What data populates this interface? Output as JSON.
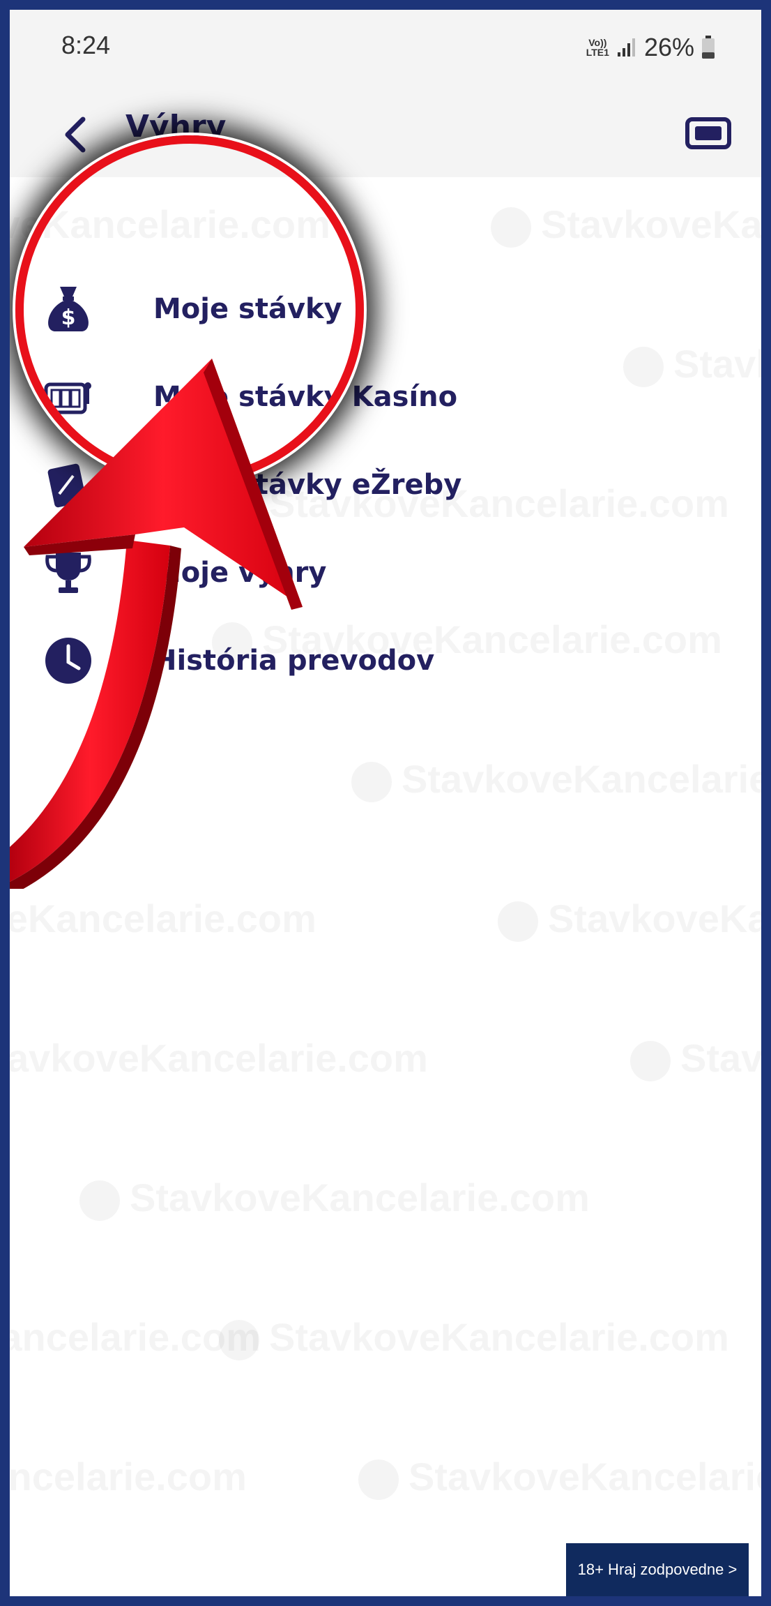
{
  "status_bar": {
    "time": "8:24",
    "volte_top": "Vo))",
    "volte_bottom": "LTE1",
    "battery": "26%"
  },
  "app_bar": {
    "title": "Výhry",
    "back_icon": "chevron-left-icon",
    "ticket_icon": "ticket-icon"
  },
  "menu": {
    "items": [
      {
        "label": "Moje stávky",
        "icon": "money-bag-icon"
      },
      {
        "label": "Moje stávky Kasíno",
        "icon": "slot-machine-icon"
      },
      {
        "label": "Moje stávky eŽreby",
        "icon": "scratch-card-icon"
      },
      {
        "label": "Moje výhry",
        "icon": "trophy-icon"
      },
      {
        "label": "História prevodov",
        "icon": "clock-icon"
      }
    ]
  },
  "watermark_text": "StavkoveKancelarie.com",
  "footer": {
    "responsible_gaming": "18+ Hraj zodpovedne >"
  },
  "colors": {
    "accent": "#232060",
    "frame": "#1d3479",
    "highlight": "#e8101a"
  }
}
